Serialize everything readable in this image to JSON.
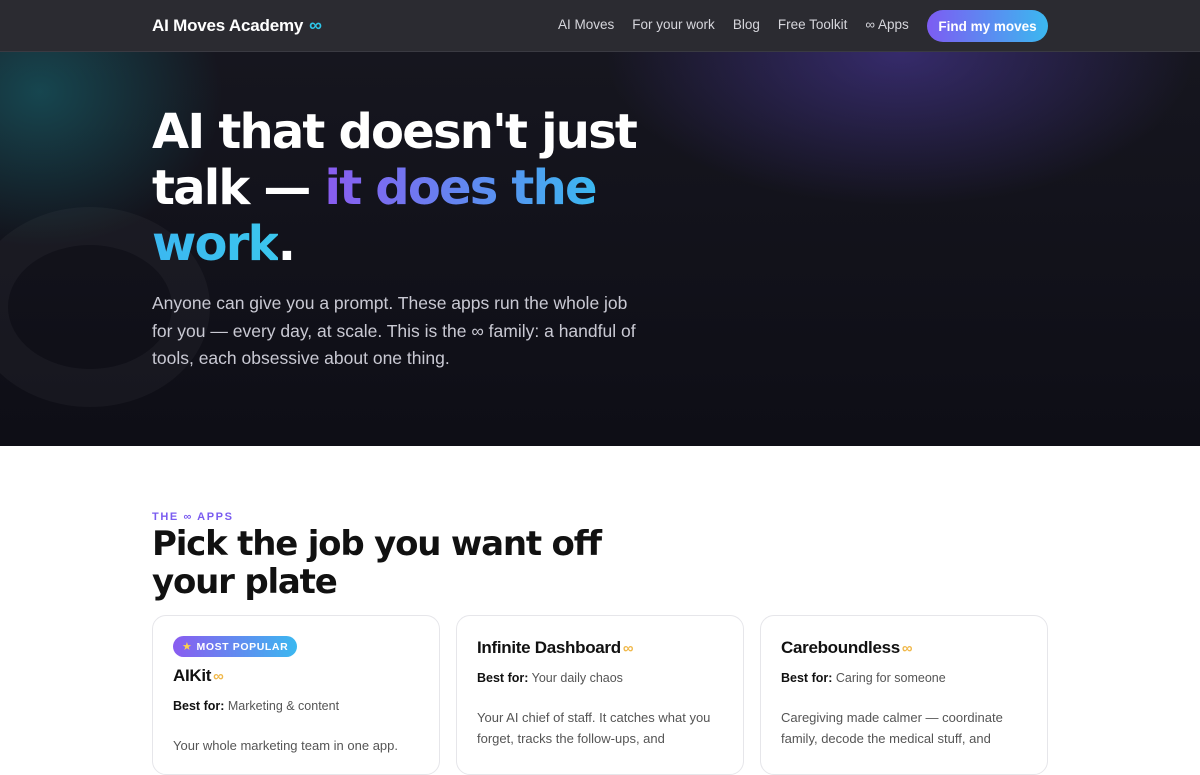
{
  "nav": {
    "brand": "AI Moves Academy",
    "brand_symbol": "∞",
    "links": [
      "AI Moves",
      "For your work",
      "Blog",
      "Free Toolkit"
    ],
    "apps_symbol": "∞",
    "apps_label": "Apps",
    "cta": "Find my moves"
  },
  "hero": {
    "title_line1": "AI that doesn't just",
    "title_line2_plain": "talk — ",
    "title_line2_grad": "it does the",
    "title_line3_grad": "work",
    "title_line3_end": ".",
    "subtitle": "Anyone can give you a prompt. These apps run the whole job for you — every day, at scale. This is the ∞ family: a handful of tools, each obsessive about one thing."
  },
  "section": {
    "eyebrow": "THE ∞ APPS",
    "title": "Pick the job you want off your plate"
  },
  "cards": [
    {
      "badge_icon": "★",
      "badge": "MOST POPULAR",
      "name": "AIKit",
      "symbol": "∞",
      "best_label": "Best for:",
      "best_value": "Marketing & content",
      "description": "Your whole marketing team in one app."
    },
    {
      "name": "Infinite Dashboard",
      "symbol": "∞",
      "best_label": "Best for:",
      "best_value": "Your daily chaos",
      "description": "Your AI chief of staff. It catches what you forget, tracks the follow-ups, and"
    },
    {
      "name": "Careboundless",
      "symbol": "∞",
      "best_label": "Best for:",
      "best_value": "Caring for someone",
      "description": "Caregiving made calmer — coordinate family, decode the medical stuff, and"
    }
  ],
  "colors": {
    "nav_bg": "#2b2b31",
    "accent_purple": "#7a5cf0",
    "accent_cyan": "#3bb8f0",
    "infinity_gold": "#f0b84a"
  }
}
